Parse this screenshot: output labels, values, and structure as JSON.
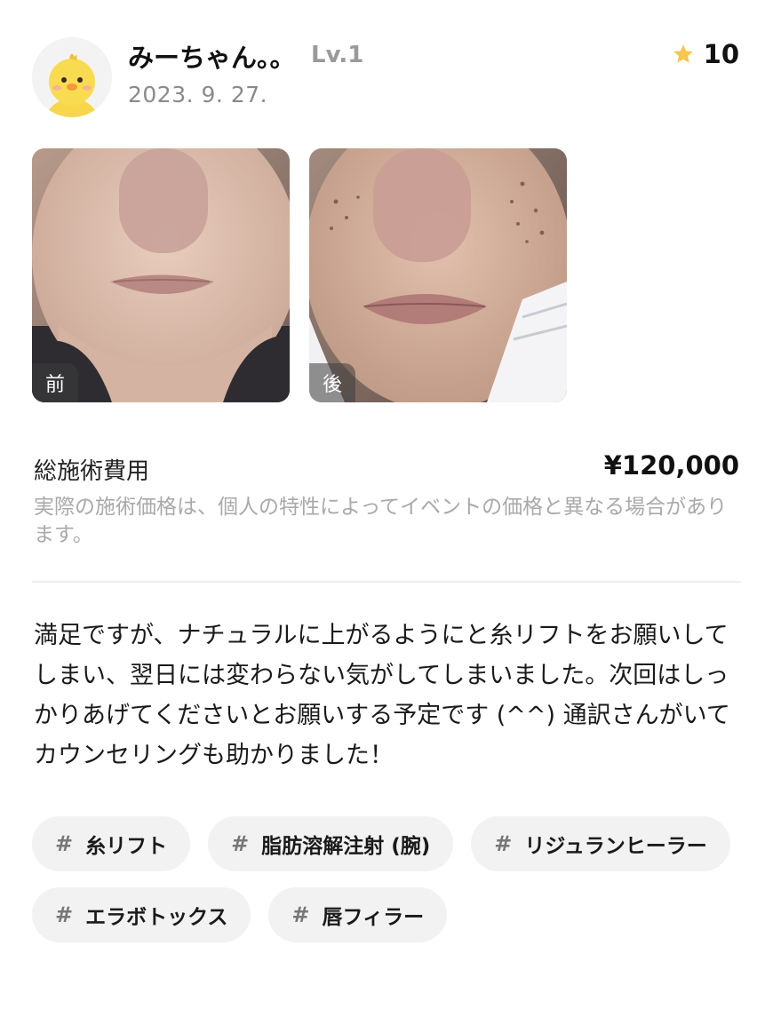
{
  "header": {
    "username": "みーちゃん。。",
    "level": "Lv.1",
    "date": "2023. 9. 27.",
    "score": "10"
  },
  "photos": [
    {
      "label": "前"
    },
    {
      "label": "後"
    }
  ],
  "cost": {
    "label": "総施術費用",
    "value": "¥120,000",
    "note": "実際の施術価格は、個人の特性によってイベントの価格と異なる場合があります。"
  },
  "review": {
    "text": "満足ですが、ナチュラルに上がるようにと糸リフトをお願いしてしまい、翌日には変わらない気がしてしまいました。次回はしっかりあげてくださいとお願いする予定です (^^) 通訳さんがいてカウンセリングも助かりました！"
  },
  "tags": [
    {
      "label": "糸リフト"
    },
    {
      "label": "脂肪溶解注射 (腕)"
    },
    {
      "label": "リジュランヒーラー"
    },
    {
      "label": "エラボトックス"
    },
    {
      "label": "唇フィラー"
    }
  ],
  "colors": {
    "star": "#f7c64a",
    "tag_bg": "#f2f2f2",
    "muted_text": "#a9a9a9"
  },
  "icons": {
    "rating": "star-icon",
    "tag": "hash-icon",
    "avatar": "chick-avatar-icon"
  }
}
